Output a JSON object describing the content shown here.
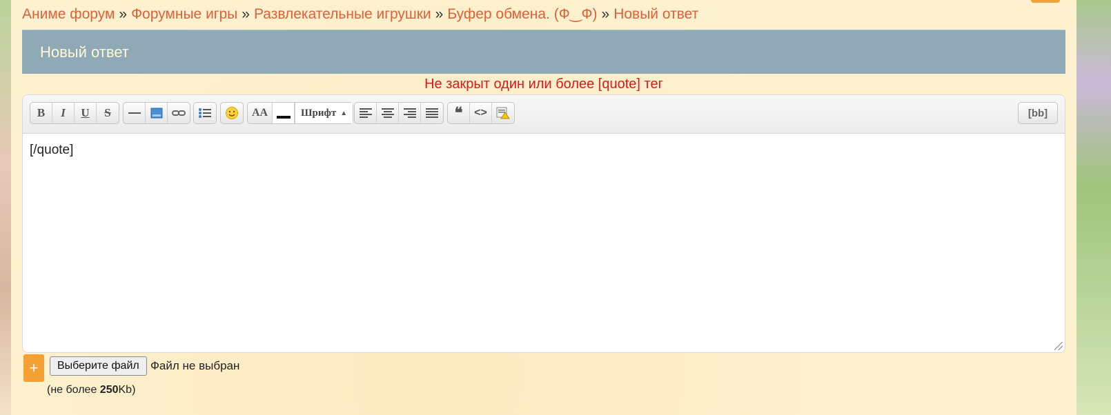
{
  "breadcrumb": {
    "items": [
      "Аниме форум",
      "Форумные игры",
      "Развлекательные игрушки",
      "Буфер обмена. (Ф‿Ф)",
      "Новый ответ"
    ],
    "separator": "»"
  },
  "header": {
    "title": "Новый ответ"
  },
  "error": {
    "message": "Не закрыт один или более [quote] тег"
  },
  "toolbar": {
    "bold": "B",
    "italic": "I",
    "underline": "U",
    "strike": "S",
    "font_size": "AA",
    "font_label": "Шрифт",
    "bb_label": "[bb]",
    "quote_glyph": "❝",
    "code_glyph": "<>"
  },
  "editor": {
    "content": "[/quote]"
  },
  "upload": {
    "plus": "+",
    "choose_file": "Выберите файл",
    "status": "Файл не выбран",
    "note_prefix": "(не более ",
    "note_size": "250",
    "note_suffix": "Kb)"
  },
  "colors": {
    "link": "#e0603a",
    "header_bar": "#8faab6",
    "error": "#d81b1b",
    "accent": "#f5a033"
  }
}
